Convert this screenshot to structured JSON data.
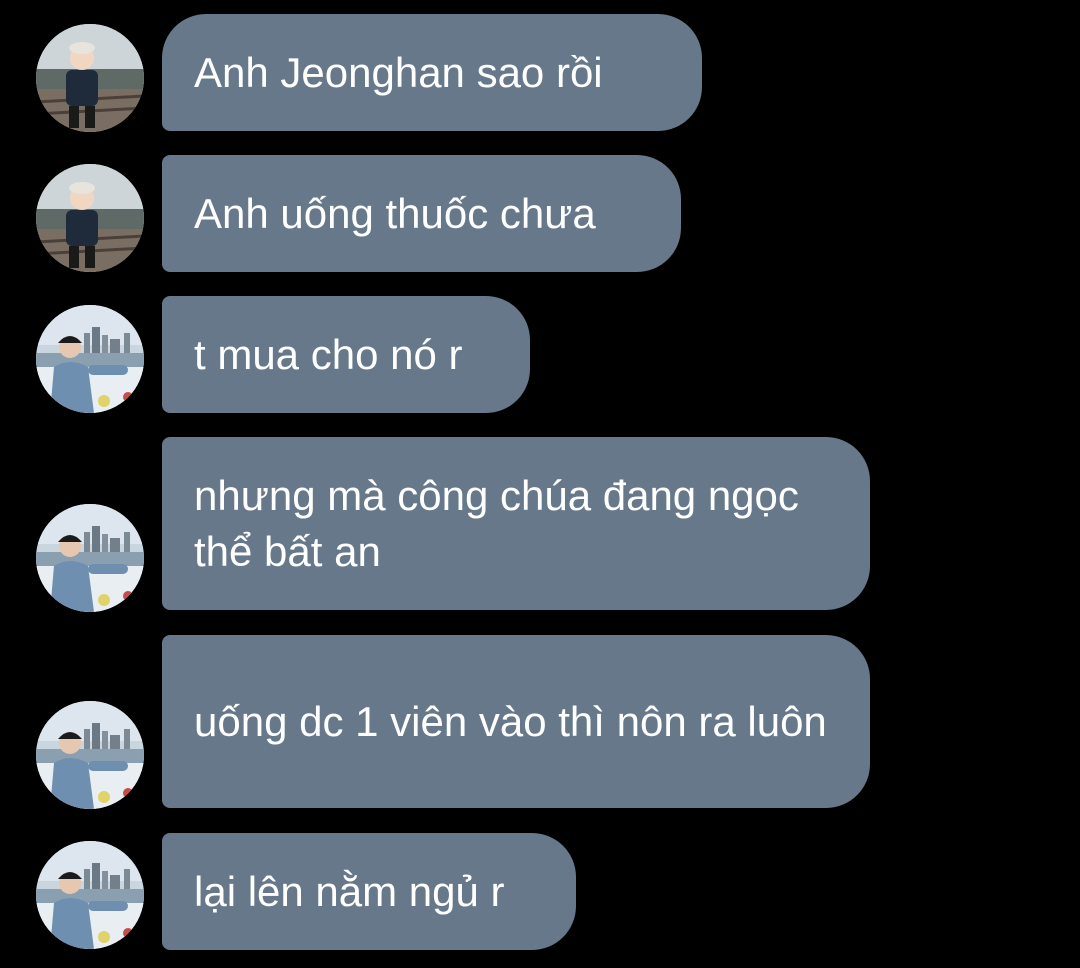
{
  "colors": {
    "background": "#000000",
    "bubble": "#66788a",
    "text": "#ffffff"
  },
  "messages": [
    {
      "sender": "child",
      "text": "Anh Jeonghan sao rồi"
    },
    {
      "sender": "child",
      "text": "Anh uống thuốc chưa"
    },
    {
      "sender": "man",
      "text": "t mua cho nó r"
    },
    {
      "sender": "man",
      "text": "nhưng mà công chúa đang ngọc thể bất an"
    },
    {
      "sender": "man",
      "text": "uống dc 1 viên vào thì nôn ra luôn"
    },
    {
      "sender": "man",
      "text": "lại lên nằm ngủ r"
    }
  ]
}
